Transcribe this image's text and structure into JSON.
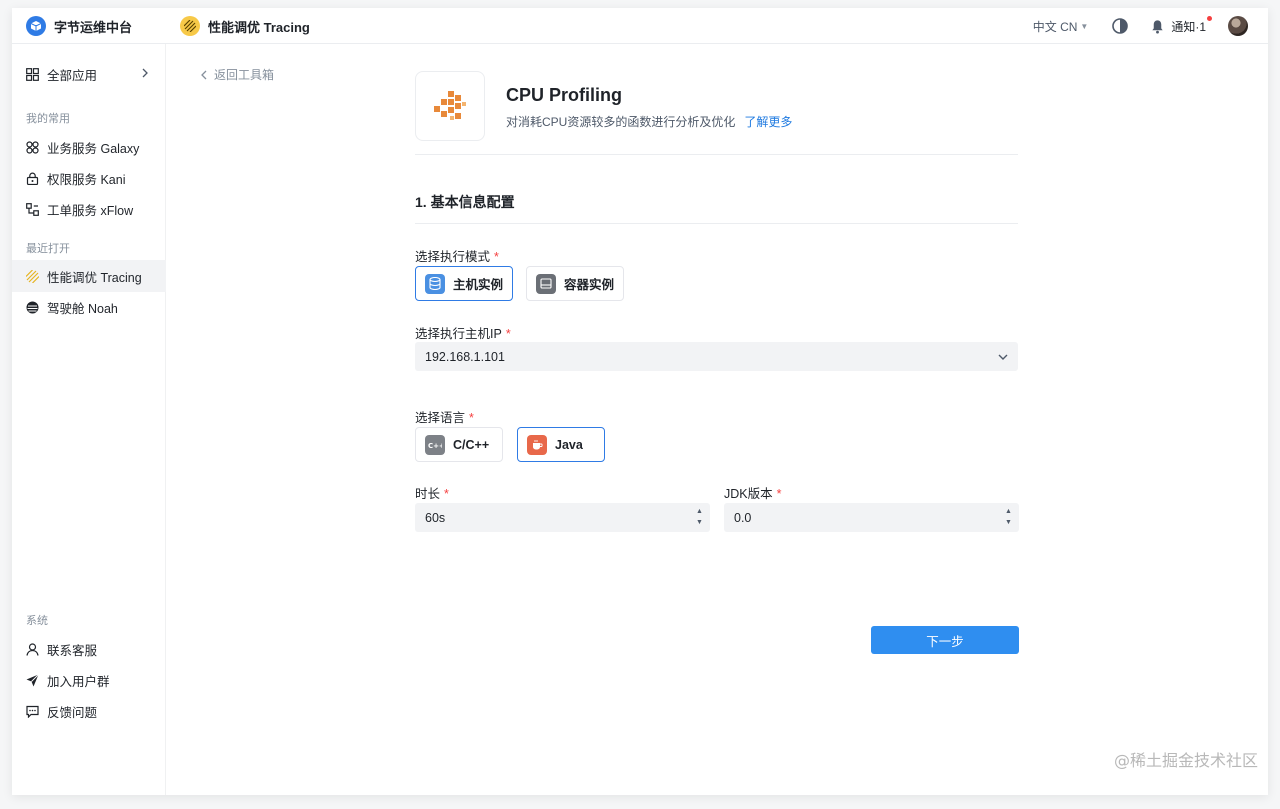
{
  "brand": {
    "name": "字节运维中台"
  },
  "app": {
    "title": "性能调优 Tracing"
  },
  "topbar": {
    "language": "中文 CN",
    "notifications": "通知·1"
  },
  "sidebar": {
    "all_apps": "全部应用",
    "favorites_title": "我的常用",
    "favorites": [
      {
        "label": "业务服务 Galaxy",
        "icon": "cluster-icon"
      },
      {
        "label": "权限服务 Kani",
        "icon": "lock-icon"
      },
      {
        "label": "工单服务 xFlow",
        "icon": "flow-icon"
      }
    ],
    "recent_title": "最近打开",
    "recent": [
      {
        "label": "性能调优 Tracing",
        "icon": "tracing-icon",
        "active": true
      },
      {
        "label": "驾驶舱 Noah",
        "icon": "noah-icon",
        "active": false
      }
    ],
    "system_title": "系统",
    "system": [
      {
        "label": "联系客服",
        "icon": "user-icon"
      },
      {
        "label": "加入用户群",
        "icon": "send-icon"
      },
      {
        "label": "反馈问题",
        "icon": "message-icon"
      }
    ]
  },
  "main": {
    "back": "返回工具箱",
    "title": "CPU Profiling",
    "description": "对消耗CPU资源较多的函数进行分析及优化",
    "learn_more": "了解更多",
    "section_title": "1. 基本信息配置",
    "mode": {
      "label": "选择执行模式",
      "options": [
        {
          "label": "主机实例",
          "icon": "database-icon",
          "selected": true
        },
        {
          "label": "容器实例",
          "icon": "container-icon",
          "selected": false
        }
      ]
    },
    "host_ip": {
      "label": "选择执行主机IP",
      "value": "192.168.1.101"
    },
    "language": {
      "label": "选择语言",
      "options": [
        {
          "label": "C/C++",
          "icon": "cpp-icon",
          "selected": false
        },
        {
          "label": "Java",
          "icon": "java-icon",
          "selected": true
        }
      ]
    },
    "duration": {
      "label": "时长",
      "value": "60s"
    },
    "jdk": {
      "label": "JDK版本",
      "value": "0.0"
    },
    "next": "下一步",
    "required_mark": "*"
  },
  "watermark": "@稀土掘金技术社区",
  "colors": {
    "primary": "#2f8ef0",
    "required": "#f53f3f",
    "accent_orange": "#e8893a"
  }
}
